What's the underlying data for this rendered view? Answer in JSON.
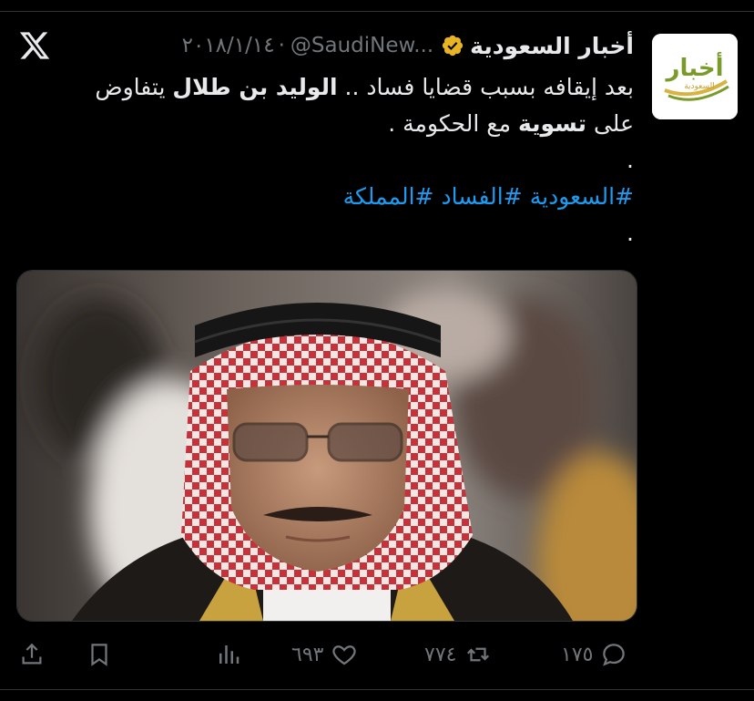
{
  "tweet": {
    "display_name": "أخبار السعودية",
    "handle": "@SaudiNew...",
    "separator": "·",
    "date": "٢٠١٨/١/١٤",
    "text": {
      "line1_pre": "بعد إيقافه بسبب قضايا فساد .. ",
      "line1_bold": "الوليد بن طلال",
      "line1_post": " يتفاوض",
      "line2_pre": "على ",
      "line2_bold": "تسوية",
      "line2_post": " مع الحكومة .",
      "dot1": ".",
      "dot2": "."
    },
    "hashtags": [
      "#السعودية",
      "#الفساد",
      "#المملكة"
    ]
  },
  "avatar": {
    "logo_text": "أخبار",
    "logo_sub": "السعودية",
    "brand_color": "#7a9a2a",
    "accent_color": "#d8b340"
  },
  "actions": {
    "replies": "١٧٥",
    "retweets": "٧٧٤",
    "likes": "٦٩٣"
  },
  "colors": {
    "background": "#000000",
    "text": "#e7e9ea",
    "muted": "#71767b",
    "link": "#1d9bf0",
    "verified_badge": "#e8b423"
  },
  "icons": {
    "platform": "x-logo-icon",
    "verified": "verified-badge-icon",
    "reply": "reply-icon",
    "retweet": "retweet-icon",
    "like": "heart-icon",
    "views": "views-icon",
    "bookmark": "bookmark-icon",
    "share": "share-icon"
  }
}
